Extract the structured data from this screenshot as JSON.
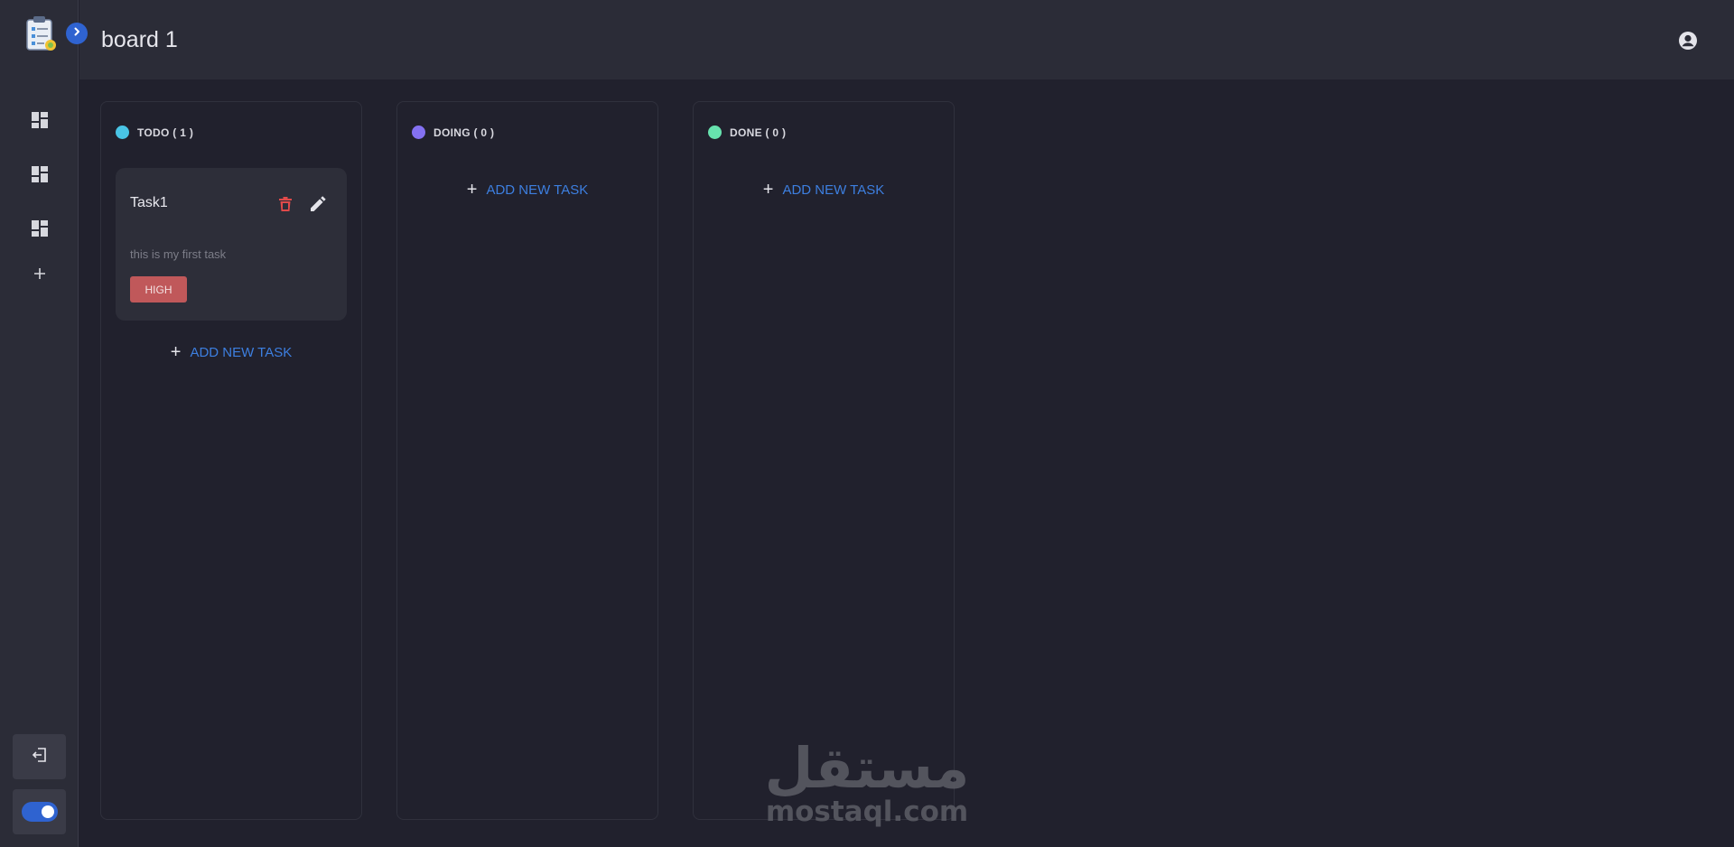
{
  "header": {
    "board_title": "board 1"
  },
  "sidebar": {
    "items": [
      {
        "name": "board-1",
        "icon": "dashboard-icon"
      },
      {
        "name": "board-2",
        "icon": "dashboard-icon"
      },
      {
        "name": "board-3",
        "icon": "dashboard-icon"
      },
      {
        "name": "add-board",
        "icon": "plus-icon"
      }
    ],
    "logout_icon": "logout-icon",
    "theme_toggle": {
      "state": "on",
      "icon": "toggle-icon"
    }
  },
  "columns": [
    {
      "title": "TODO ( 1 )",
      "color": "#49c4e5",
      "add_label": "ADD NEW TASK"
    },
    {
      "title": "DOING ( 0 )",
      "color": "#8471f2",
      "add_label": "ADD NEW TASK"
    },
    {
      "title": "DONE ( 0 )",
      "color": "#67e2ae",
      "add_label": "ADD NEW TASK"
    }
  ],
  "tasks": [
    {
      "title": "Task1",
      "description": "this is my first task",
      "priority": "HIGH",
      "priority_color": "#c0585a"
    }
  ],
  "colors": {
    "accent": "#2f63d0",
    "link": "#3d7fe0",
    "background": "#21212d",
    "panel": "#2b2c37",
    "delete": "#e04a4a"
  },
  "watermark": {
    "arabic": "مستقل",
    "latin": "mostaql.com"
  }
}
